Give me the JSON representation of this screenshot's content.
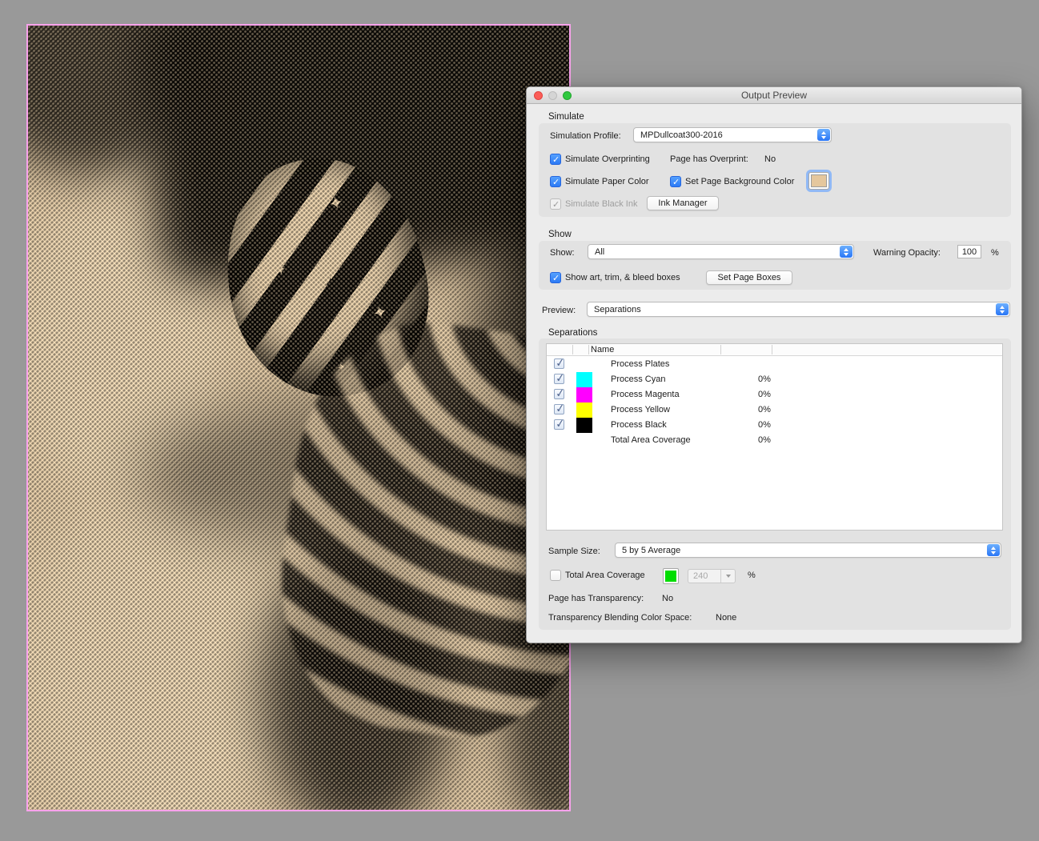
{
  "desktop_bg": "#999999",
  "artwork": {
    "border_color": "#f9a2ec",
    "paper_color": "#e9d0ab",
    "ink_color": "#0b0906"
  },
  "window": {
    "title": "Output Preview",
    "accent_blue": "#2c7af5",
    "simulate": {
      "section_label": "Simulate",
      "profile_label": "Simulation Profile:",
      "profile_value": "MPDullcoat300-2016",
      "overprinting_label": "Simulate Overprinting",
      "overprint_status_label": "Page has Overprint:",
      "overprint_status_value": "No",
      "paper_color_label": "Simulate Paper Color",
      "bg_color_label": "Set Page Background Color",
      "bg_swatch_color": "#e5c79d",
      "black_ink_label": "Simulate Black Ink",
      "ink_manager_label": "Ink Manager"
    },
    "show": {
      "section_label": "Show",
      "show_label": "Show:",
      "show_value": "All",
      "warning_opacity_label": "Warning Opacity:",
      "warning_opacity_value": "100",
      "percent": "%",
      "boxes_label": "Show art, trim, & bleed boxes",
      "set_page_boxes_label": "Set Page Boxes"
    },
    "preview": {
      "label": "Preview:",
      "value": "Separations"
    },
    "separations": {
      "section_label": "Separations",
      "name_header": "Name",
      "rows": [
        {
          "name": "Process Plates",
          "value": "",
          "swatch_color": ""
        },
        {
          "name": "Process Cyan",
          "value": "0%",
          "swatch_color": "#00ffff"
        },
        {
          "name": "Process Magenta",
          "value": "0%",
          "swatch_color": "#ff00ff"
        },
        {
          "name": "Process Yellow",
          "value": "0%",
          "swatch_color": "#ffff00"
        },
        {
          "name": "Process Black",
          "value": "0%",
          "swatch_color": "#000000"
        },
        {
          "name": "Total Area Coverage",
          "value": "0%",
          "swatch_color": ""
        }
      ]
    },
    "footer": {
      "sample_size_label": "Sample Size:",
      "sample_size_value": "5 by 5 Average",
      "tac_label": "Total Area Coverage",
      "tac_swatch_color": "#00dd00",
      "tac_value": "240",
      "percent": "%",
      "transparency_label": "Page has Transparency:",
      "transparency_value": "No",
      "blend_label": "Transparency Blending Color Space:",
      "blend_value": "None"
    }
  }
}
